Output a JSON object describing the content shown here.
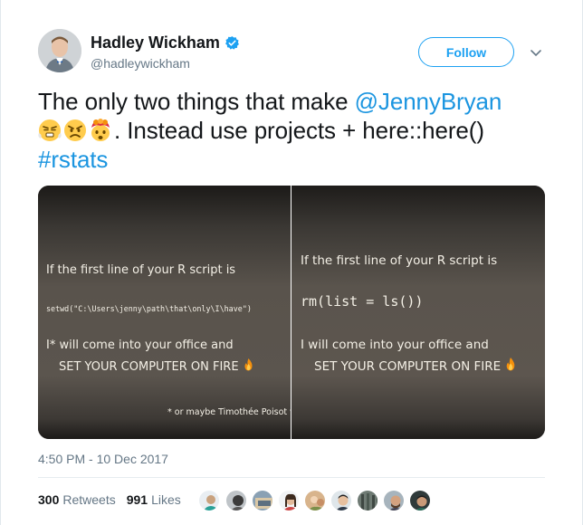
{
  "user": {
    "name": "Hadley Wickham",
    "handle": "@hadleywickham",
    "verified": true
  },
  "follow_label": "Follow",
  "tweet": {
    "line1_text": "The only two things that make ",
    "mention": "@JennyBryan",
    "emojis": [
      "triumph-face",
      "angry-face",
      "exploding-head"
    ],
    "line2_text": ". Instead use projects + here::here()",
    "hashtag": "#rstats"
  },
  "media": {
    "left_slide": {
      "line1": "If the first line of your R script is",
      "code": "setwd(\"C:\\Users\\jenny\\path\\that\\only\\I\\have\")",
      "line3": "I* will come into your office and",
      "line4": "SET YOUR COMPUTER ON FIRE",
      "footnote": "* or maybe Timothée Poisot w"
    },
    "right_slide": {
      "line1": "If the first line of your R script is",
      "code": "rm(list = ls())",
      "line3": "I will come into your office and",
      "line4": "SET YOUR COMPUTER ON FIRE"
    }
  },
  "timestamp": "4:50 PM - 10 Dec 2017",
  "stats": {
    "retweets_count": "300",
    "retweets_label": "Retweets",
    "likes_count": "991",
    "likes_label": "Likes"
  },
  "likers_count": 10,
  "colors": {
    "link": "#1b95e0",
    "follow_border": "#1da1f2",
    "secondary_text": "#657786"
  }
}
